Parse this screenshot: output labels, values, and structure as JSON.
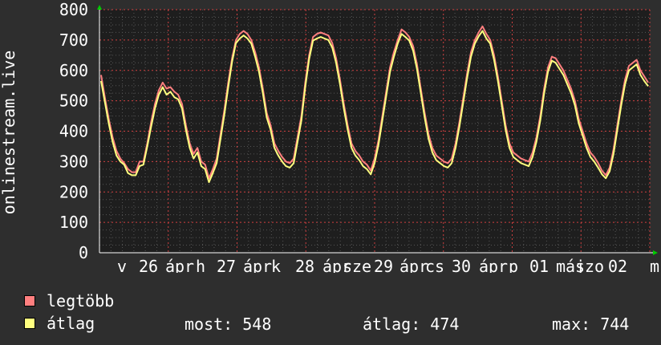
{
  "chart_data": {
    "type": "line",
    "ylabel": "onlinestream.live",
    "ylim": [
      0,
      800
    ],
    "yticks": [
      "800",
      "700",
      "600",
      "500",
      "400",
      "300",
      "200",
      "100",
      "0"
    ],
    "xticks": [
      "v",
      "26",
      "ápr",
      "h",
      "27",
      "ápr",
      "k",
      "28",
      "ápr",
      "sze",
      "29",
      "ápr",
      "cs",
      "30",
      "ápr",
      "p",
      "01",
      "máj",
      "szo",
      "02",
      "m"
    ],
    "grid": true,
    "series": [
      {
        "name": "legtöbb",
        "color": "#ff7f7f",
        "values": [
          585,
          510,
          440,
          380,
          335,
          310,
          295,
          275,
          265,
          265,
          300,
          300,
          360,
          430,
          490,
          535,
          560,
          540,
          545,
          530,
          520,
          490,
          420,
          360,
          325,
          345,
          300,
          290,
          245,
          275,
          310,
          390,
          470,
          560,
          640,
          700,
          720,
          730,
          720,
          700,
          660,
          610,
          540,
          460,
          420,
          360,
          335,
          315,
          300,
          295,
          310,
          380,
          450,
          560,
          650,
          710,
          720,
          725,
          720,
          715,
          690,
          640,
          570,
          490,
          420,
          360,
          335,
          320,
          300,
          290,
          270,
          310,
          370,
          450,
          530,
          610,
          660,
          700,
          735,
          725,
          710,
          680,
          620,
          540,
          460,
          390,
          345,
          320,
          310,
          300,
          295,
          310,
          360,
          430,
          510,
          590,
          660,
          700,
          725,
          745,
          720,
          700,
          650,
          580,
          500,
          420,
          360,
          330,
          320,
          310,
          305,
          300,
          330,
          380,
          450,
          540,
          610,
          645,
          640,
          620,
          600,
          570,
          540,
          500,
          440,
          400,
          360,
          330,
          315,
          295,
          270,
          255,
          280,
          340,
          420,
          500,
          570,
          615,
          625,
          635,
          600,
          580,
          560
        ]
      },
      {
        "name": "átlag",
        "color": "#ffff7f",
        "values": [
          565,
          495,
          425,
          365,
          320,
          300,
          290,
          262,
          255,
          255,
          285,
          290,
          350,
          415,
          475,
          520,
          545,
          520,
          530,
          512,
          505,
          475,
          405,
          345,
          310,
          330,
          285,
          275,
          232,
          262,
          295,
          375,
          455,
          545,
          628,
          690,
          705,
          715,
          705,
          688,
          645,
          595,
          525,
          445,
          405,
          345,
          320,
          300,
          285,
          280,
          295,
          365,
          435,
          545,
          638,
          698,
          705,
          710,
          705,
          700,
          675,
          625,
          555,
          475,
          405,
          345,
          320,
          305,
          285,
          275,
          258,
          295,
          355,
          435,
          515,
          595,
          645,
          688,
          720,
          710,
          698,
          665,
          605,
          525,
          445,
          375,
          330,
          305,
          295,
          285,
          280,
          295,
          345,
          415,
          495,
          575,
          645,
          688,
          712,
          730,
          705,
          688,
          635,
          565,
          485,
          405,
          345,
          315,
          305,
          295,
          290,
          285,
          315,
          365,
          435,
          525,
          595,
          632,
          625,
          605,
          585,
          555,
          525,
          485,
          425,
          385,
          345,
          315,
          300,
          280,
          258,
          245,
          268,
          325,
          405,
          485,
          555,
          600,
          610,
          620,
          585,
          565,
          548
        ]
      }
    ]
  },
  "legend": [
    {
      "label": "legtöbb",
      "color": "#ff7f7f"
    },
    {
      "label": "átlag",
      "color": "#ffff7f"
    }
  ],
  "stats": {
    "most": "most: 548",
    "atlag": "átlag: 474",
    "max": "max: 744"
  }
}
